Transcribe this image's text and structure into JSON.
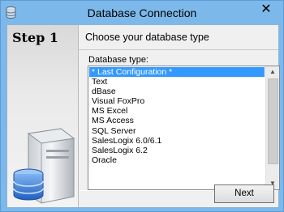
{
  "window": {
    "title": "Database Connection",
    "close_glyph": "✕",
    "app_icon": "database-icon"
  },
  "wizard": {
    "step_label": "Step 1",
    "header": "Choose your database type"
  },
  "database_type": {
    "label": "Database type:",
    "items": [
      "* Last Configuration *",
      "Text",
      "dBase",
      "Visual FoxPro",
      "MS Excel",
      "MS Access",
      "SQL Server",
      "SalesLogix 6.0/6.1",
      "SalesLogix 6.2",
      "Oracle"
    ],
    "selected_index": 0
  },
  "buttons": {
    "next": "Next"
  },
  "scrollbar": {
    "up_glyph": "▲",
    "down_glyph": "▼"
  },
  "colors": {
    "titlebar": "#7db8ea",
    "selection": "#3399ff"
  }
}
